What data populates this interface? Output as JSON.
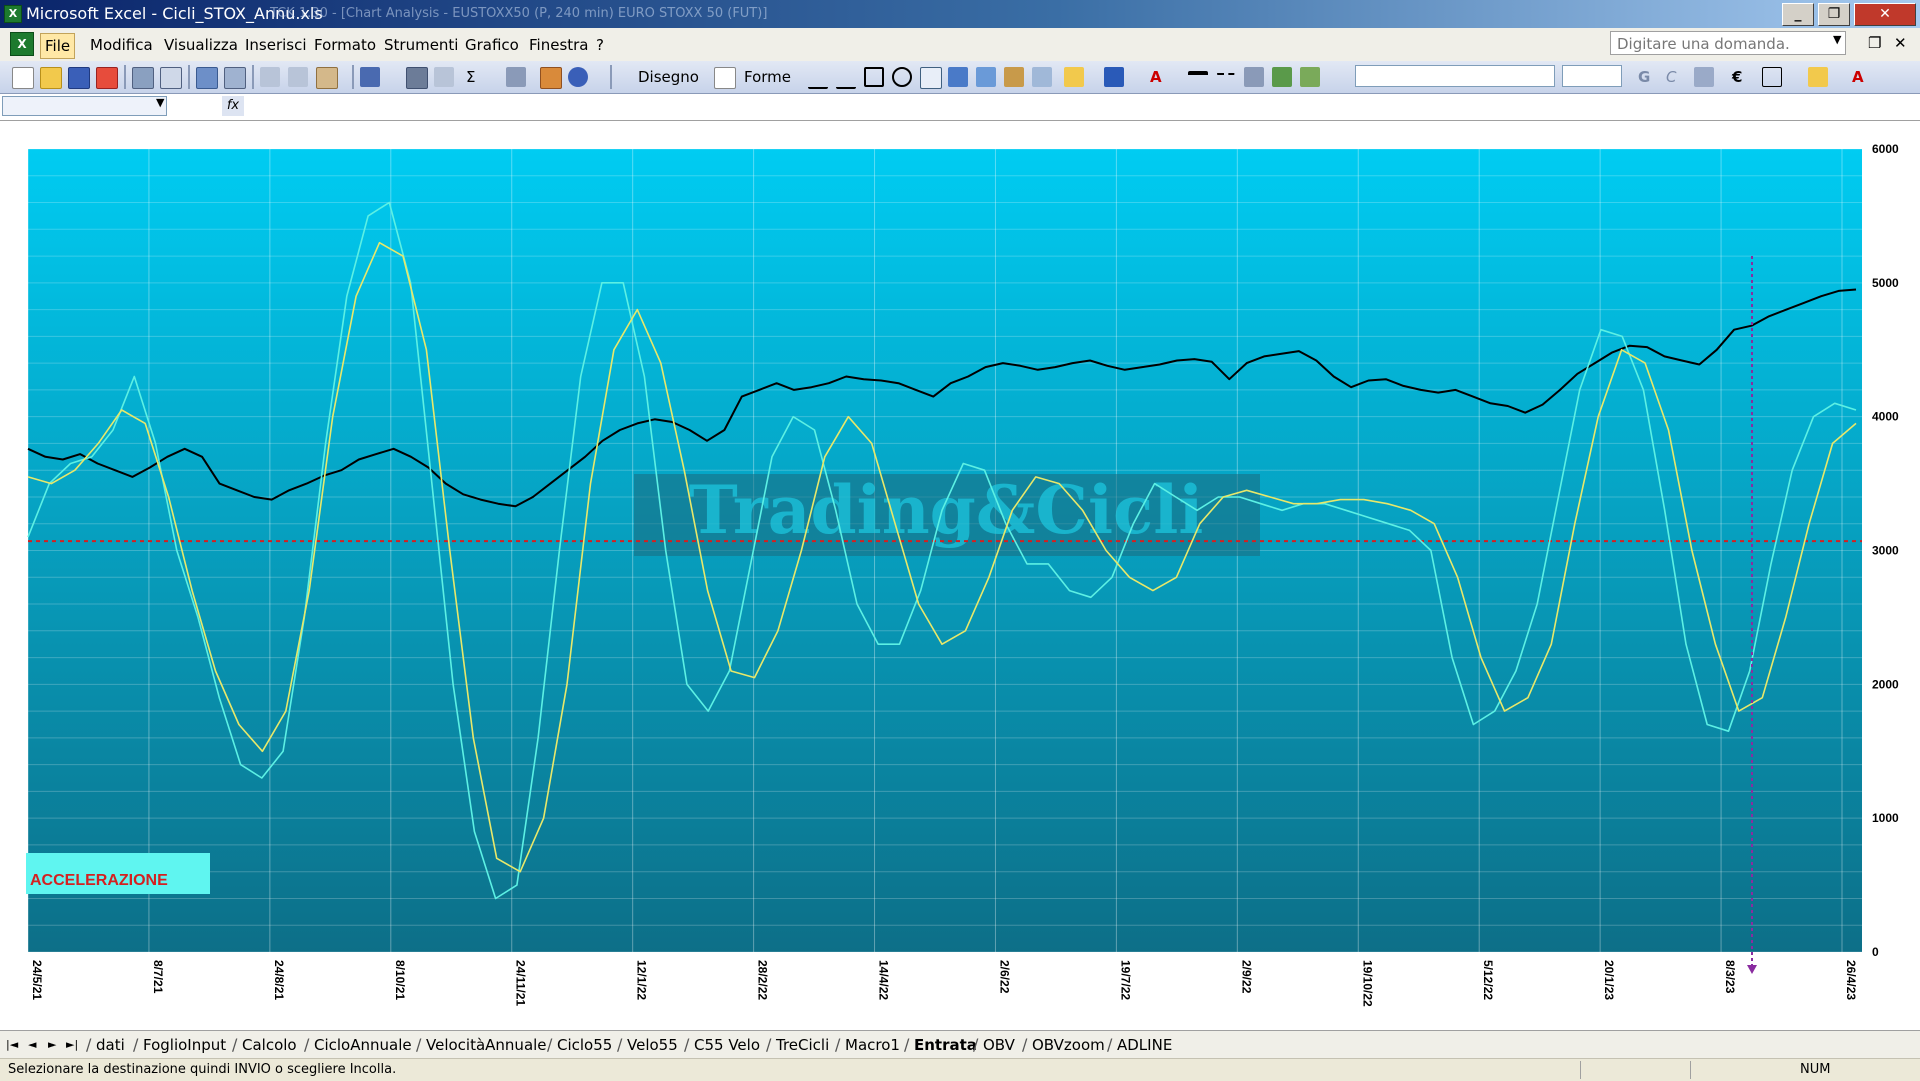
{
  "window": {
    "title": "Microsoft Excel - Cicli_STOX_Annu.xls",
    "ghost_title": "TCK 1.30 - [Chart Analysis - EUSTOXX50 (P, 240 min) EURO STOXX 50 (FUT)]",
    "minimize_label": "_",
    "restore_label": "❐",
    "close_label": "✕"
  },
  "menu": {
    "items": [
      "File",
      "Modifica",
      "Visualizza",
      "Inserisci",
      "Formato",
      "Strumenti",
      "Grafico",
      "Finestra",
      "?"
    ],
    "ask_placeholder": "Digitare una domanda.",
    "mdi_restore": "❐",
    "mdi_close": "✕"
  },
  "toolbar": {
    "disegno_label": "Disegno",
    "forme_label": "Forme",
    "bold_label": "G",
    "italic_label": "C",
    "euro_label": "€",
    "fontcolor_label": "A",
    "sigma_label": "Σ"
  },
  "formula": {
    "fx_label": "fx"
  },
  "chart_data": {
    "type": "line",
    "xlabel": "",
    "ylabel": "",
    "y_right_ticks": [
      "6000",
      "5000",
      "4000",
      "3000",
      "2000",
      "1000",
      "0"
    ],
    "ylim": [
      0,
      6000
    ],
    "x_ticks": [
      "24/5/21",
      "8/7/21",
      "24/8/21",
      "8/10/21",
      "24/11/21",
      "12/1/22",
      "28/2/22",
      "14/4/22",
      "2/6/22",
      "19/7/22",
      "2/9/22",
      "19/10/22",
      "5/12/22",
      "20/1/23",
      "8/3/23",
      "26/4/23"
    ],
    "watermark": "Trading&Cicli",
    "label_box": "ACCELERAZIONE",
    "reference_line": 3070,
    "grid": true,
    "colors": {
      "background_top": "#00ccf2",
      "background_bottom": "#0d6f88",
      "price": "#000000",
      "cyan": "#5cf0e4",
      "yellow": "#e8e86a",
      "reference": "#d42020",
      "marker": "#8a2ca0",
      "label_text": "#d42020",
      "label_bg": "#5ff5f0"
    },
    "series": [
      {
        "key": "price",
        "values": [
          3760,
          3700,
          3680,
          3720,
          3650,
          3600,
          3550,
          3620,
          3700,
          3760,
          3700,
          3500,
          3450,
          3400,
          3380,
          3450,
          3500,
          3560,
          3600,
          3680,
          3720,
          3760,
          3700,
          3620,
          3500,
          3420,
          3380,
          3350,
          3330,
          3400,
          3500,
          3600,
          3700,
          3820,
          3900,
          3950,
          3980,
          3960,
          3900,
          3820,
          3900,
          4150,
          4200,
          4250,
          4200,
          4220,
          4250,
          4300,
          4280,
          4270,
          4250,
          4200,
          4150,
          4250,
          4300,
          4370,
          4400,
          4380,
          4350,
          4370,
          4400,
          4420,
          4380,
          4350,
          4370,
          4390,
          4420,
          4430,
          4410,
          4280,
          4400,
          4450,
          4470,
          4490,
          4420,
          4300,
          4220,
          4270,
          4280,
          4230,
          4200,
          4180,
          4200,
          4150,
          4100,
          4080,
          4030,
          4090,
          4200,
          4320,
          4400,
          4480,
          4530,
          4520,
          4450,
          4420,
          4390,
          4500,
          4650,
          4680,
          4750,
          4800,
          4850,
          4900,
          4940,
          4950
        ]
      },
      {
        "key": "cyan",
        "values": [
          3100,
          3500,
          3650,
          3700,
          3900,
          4300,
          3800,
          3000,
          2500,
          1900,
          1400,
          1300,
          1500,
          2500,
          3800,
          4900,
          5500,
          5600,
          5000,
          3500,
          2000,
          900,
          400,
          500,
          1600,
          3000,
          4300,
          5000,
          5000,
          4300,
          3000,
          2000,
          1800,
          2100,
          2900,
          3700,
          4000,
          3900,
          3300,
          2600,
          2300,
          2300,
          2700,
          3300,
          3650,
          3600,
          3200,
          2900,
          2900,
          2700,
          2650,
          2800,
          3200,
          3500,
          3400,
          3300,
          3400,
          3400,
          3350,
          3300,
          3350,
          3350,
          3300,
          3250,
          3200,
          3150,
          3000,
          2200,
          1700,
          1800,
          2100,
          2600,
          3400,
          4200,
          4650,
          4600,
          4200,
          3300,
          2300,
          1700,
          1650,
          2100,
          2900,
          3600,
          4000,
          4100,
          4050
        ]
      },
      {
        "key": "yellow",
        "values": [
          3550,
          3500,
          3600,
          3800,
          4050,
          3950,
          3400,
          2700,
          2100,
          1700,
          1500,
          1800,
          2700,
          4000,
          4900,
          5300,
          5200,
          4500,
          3000,
          1600,
          700,
          600,
          1000,
          2000,
          3500,
          4500,
          4800,
          4400,
          3600,
          2700,
          2100,
          2050,
          2400,
          3000,
          3700,
          4000,
          3800,
          3200,
          2600,
          2300,
          2400,
          2800,
          3300,
          3550,
          3500,
          3300,
          3000,
          2800,
          2700,
          2800,
          3200,
          3400,
          3450,
          3400,
          3350,
          3350,
          3380,
          3380,
          3350,
          3300,
          3200,
          2800,
          2200,
          1800,
          1900,
          2300,
          3200,
          4000,
          4500,
          4400,
          3900,
          3000,
          2300,
          1800,
          1900,
          2500,
          3200,
          3800,
          3950
        ]
      }
    ]
  },
  "sheets": {
    "tabs": [
      "dati",
      "FoglioInput",
      "Calcolo",
      "CicloAnnuale",
      "VelocitàAnnuale",
      "Ciclo55",
      "Velo55",
      "C55 Velo",
      "TreCicli",
      "Macro1",
      "Entrata",
      "OBV",
      "OBVzoom",
      "ADLINE"
    ],
    "active": "Entrata"
  },
  "status": {
    "message": "Selezionare la destinazione quindi INVIO o scegliere Incolla.",
    "num": "NUM"
  }
}
